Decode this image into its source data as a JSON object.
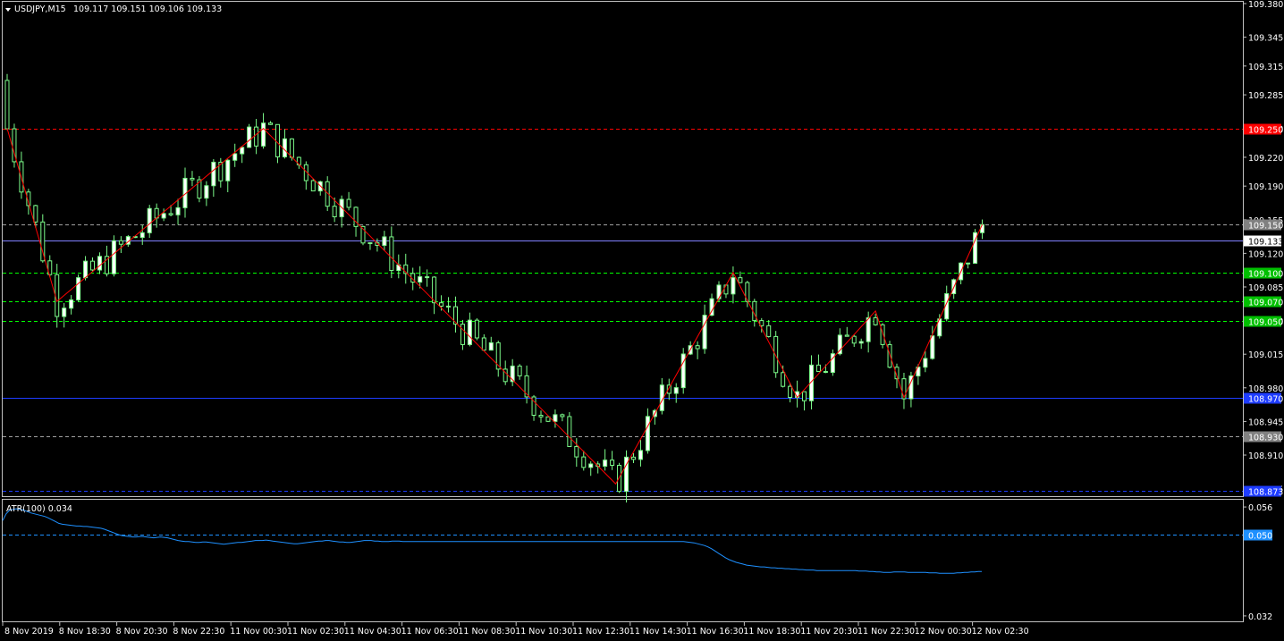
{
  "chart_window": {
    "symbol_timeframe": "USDJPY,M15",
    "ohlc": "109.117 109.151 109.106 109.133",
    "menu_icon": "triangle-down-icon"
  },
  "colors": {
    "background": "#000000",
    "frame": "#c0c0c0",
    "bull_candle": "#ffffff",
    "bear_candle": "#000000",
    "wick": "#7cfc8a",
    "zigzag": "#ff0000",
    "atr_line": "#1e90ff",
    "grid_green": "#00ff00",
    "grid_red": "#ff0000",
    "grid_blue": "#1e3cff",
    "grid_gray": "#a0a0a0"
  },
  "chart_data": [
    {
      "type": "candlestick",
      "title": "USDJPY,M15",
      "ylim": [
        108.87,
        109.38
      ],
      "y_ticks": [
        "109.380",
        "109.345",
        "109.315",
        "109.285",
        "109.250",
        "109.220",
        "109.190",
        "109.155",
        "109.120",
        "109.085",
        "109.050",
        "109.015",
        "108.980",
        "108.945",
        "108.910",
        "108.875"
      ],
      "x_ticks": [
        "8 Nov 2019",
        "8 Nov 18:30",
        "8 Nov 20:30",
        "8 Nov 22:30",
        "11 Nov 00:30",
        "11 Nov 02:30",
        "11 Nov 04:30",
        "11 Nov 06:30",
        "11 Nov 08:30",
        "11 Nov 10:30",
        "11 Nov 12:30",
        "11 Nov 14:30",
        "11 Nov 16:30",
        "11 Nov 18:30",
        "11 Nov 20:30",
        "11 Nov 22:30",
        "12 Nov 00:30",
        "12 Nov 02:30"
      ],
      "current_price": "109.133",
      "levels": [
        {
          "price": 109.25,
          "label": "109.250",
          "color": "#ff0000",
          "label_bg": "#ff0000",
          "style": "dash"
        },
        {
          "price": 109.15,
          "label": "109.150",
          "color": "#a0a0a0",
          "label_bg": "#808080",
          "style": "dash"
        },
        {
          "price": 109.133,
          "label": "109.133",
          "color": "#8080ff",
          "label_bg": "#ffffff",
          "label_fg": "#000000",
          "style": "solid"
        },
        {
          "price": 109.1,
          "label": "109.100",
          "color": "#00ff00",
          "label_bg": "#00c000",
          "style": "dash"
        },
        {
          "price": 109.07,
          "label": "109.070",
          "color": "#00ff00",
          "label_bg": "#00c000",
          "style": "dash"
        },
        {
          "price": 109.05,
          "label": "109.050",
          "color": "#00ff00",
          "label_bg": "#00c000",
          "style": "dash"
        },
        {
          "price": 108.97,
          "label": "108.970",
          "color": "#1e3cff",
          "label_bg": "#1e3cff",
          "style": "solid"
        },
        {
          "price": 108.93,
          "label": "108.930",
          "color": "#a0a0a0",
          "label_bg": "#808080",
          "style": "dash"
        },
        {
          "price": 108.873,
          "label": "108.873",
          "color": "#1e3cff",
          "label_bg": "#1e3cff",
          "style": "dash"
        }
      ],
      "zigzag": [
        [
          0,
          109.25
        ],
        [
          14,
          109.07
        ],
        [
          72,
          109.25
        ],
        [
          171,
          108.88
        ],
        [
          204,
          109.1
        ],
        [
          222,
          108.97
        ],
        [
          244,
          109.06
        ],
        [
          252,
          108.97
        ],
        [
          274,
          109.15
        ]
      ],
      "candles_note": "OHLC series approximated from the picture",
      "candles": []
    },
    {
      "type": "line",
      "title": "ATR(100) 0.034",
      "ylim": [
        0.031,
        0.057
      ],
      "y_ticks": [
        "0.056",
        "0.032"
      ],
      "marker_label": "0.050",
      "series": [
        {
          "name": "ATR(100)",
          "values": [
            0.053,
            0.0545,
            0.0553,
            0.0555,
            0.0556,
            0.0555,
            0.0553,
            0.055,
            0.0547,
            0.0545,
            0.0543,
            0.0541,
            0.0539,
            0.0536,
            0.0532,
            0.0528,
            0.0524,
            0.0522,
            0.0521,
            0.052,
            0.0519,
            0.0518,
            0.0518,
            0.0517,
            0.0517,
            0.0516,
            0.0515,
            0.0514,
            0.0513,
            0.0511,
            0.0508,
            0.0505,
            0.0502,
            0.0499,
            0.0497,
            0.0496,
            0.0495,
            0.0494,
            0.0494,
            0.0495,
            0.0495,
            0.0494,
            0.0493,
            0.0492,
            0.0493,
            0.0494,
            0.0493,
            0.0492,
            0.049,
            0.0488,
            0.0486,
            0.0485,
            0.0484,
            0.0484,
            0.0483,
            0.0482,
            0.0482,
            0.0483,
            0.0483,
            0.0482,
            0.0481,
            0.048,
            0.0479,
            0.0478,
            0.0479,
            0.048,
            0.0481,
            0.0482,
            0.0482,
            0.0483,
            0.0484,
            0.0485,
            0.0486,
            0.0486,
            0.0486,
            0.0487,
            0.0486,
            0.0485,
            0.0484,
            0.0483,
            0.0482,
            0.0481,
            0.048,
            0.0479,
            0.0479,
            0.048,
            0.0481,
            0.0482,
            0.0483,
            0.0484,
            0.0485,
            0.0485,
            0.0486,
            0.0486,
            0.0485,
            0.0484,
            0.0483,
            0.0483,
            0.0482,
            0.0482,
            0.0483,
            0.0484,
            0.0485,
            0.0486,
            0.0486,
            0.0486,
            0.0485,
            0.0485,
            0.0484,
            0.0484,
            0.0484,
            0.0485,
            0.0485,
            0.0485,
            0.0484,
            0.0484,
            0.0484,
            0.0484,
            0.0484,
            0.0484,
            0.0484,
            0.0484,
            0.0484,
            0.0484,
            0.0484,
            0.0484,
            0.0484,
            0.0484,
            0.0484,
            0.0484,
            0.0484,
            0.0484,
            0.0484,
            0.0484,
            0.0484,
            0.0484,
            0.0484,
            0.0484,
            0.0484,
            0.0484,
            0.0484,
            0.0484,
            0.0484,
            0.0484,
            0.0484,
            0.0484,
            0.0484,
            0.0484,
            0.0484,
            0.0484,
            0.0484,
            0.0484,
            0.0484,
            0.0484,
            0.0484,
            0.0484,
            0.0484,
            0.0484,
            0.0484,
            0.0484,
            0.0484,
            0.0484,
            0.0484,
            0.0484,
            0.0484,
            0.0484,
            0.0484,
            0.0484,
            0.0484,
            0.0484,
            0.0484,
            0.0484,
            0.0484,
            0.0484,
            0.0484,
            0.0484,
            0.0484,
            0.0484,
            0.0484,
            0.0484,
            0.0484,
            0.0484,
            0.0484,
            0.0484,
            0.0484,
            0.0484,
            0.0484,
            0.0484,
            0.0484,
            0.0484,
            0.0484,
            0.0484,
            0.0484,
            0.0484,
            0.0484,
            0.0483,
            0.0482,
            0.0481,
            0.0479,
            0.0477,
            0.0475,
            0.0472,
            0.0468,
            0.0463,
            0.0458,
            0.0453,
            0.0448,
            0.0444,
            0.0441,
            0.0438,
            0.0436,
            0.0434,
            0.0432,
            0.0431,
            0.043,
            0.0429,
            0.0428,
            0.0428,
            0.0427,
            0.0426,
            0.0426,
            0.0425,
            0.0425,
            0.0424,
            0.0424,
            0.0423,
            0.0423,
            0.0422,
            0.0422,
            0.0421,
            0.0421,
            0.0421,
            0.042,
            0.042,
            0.042,
            0.042,
            0.042,
            0.042,
            0.042,
            0.042,
            0.042,
            0.042,
            0.042,
            0.042,
            0.0419,
            0.0419,
            0.0419,
            0.0418,
            0.0418,
            0.0417,
            0.0417,
            0.0416,
            0.0416,
            0.0416,
            0.0417,
            0.0417,
            0.0417,
            0.0417,
            0.0416,
            0.0416,
            0.0416,
            0.0416,
            0.0416,
            0.0416,
            0.0415,
            0.0415,
            0.0415,
            0.0414,
            0.0414,
            0.0414,
            0.0414,
            0.0414,
            0.0415,
            0.0415,
            0.0416,
            0.0416,
            0.0417,
            0.0417,
            0.0418,
            0.0418
          ]
        }
      ]
    }
  ]
}
